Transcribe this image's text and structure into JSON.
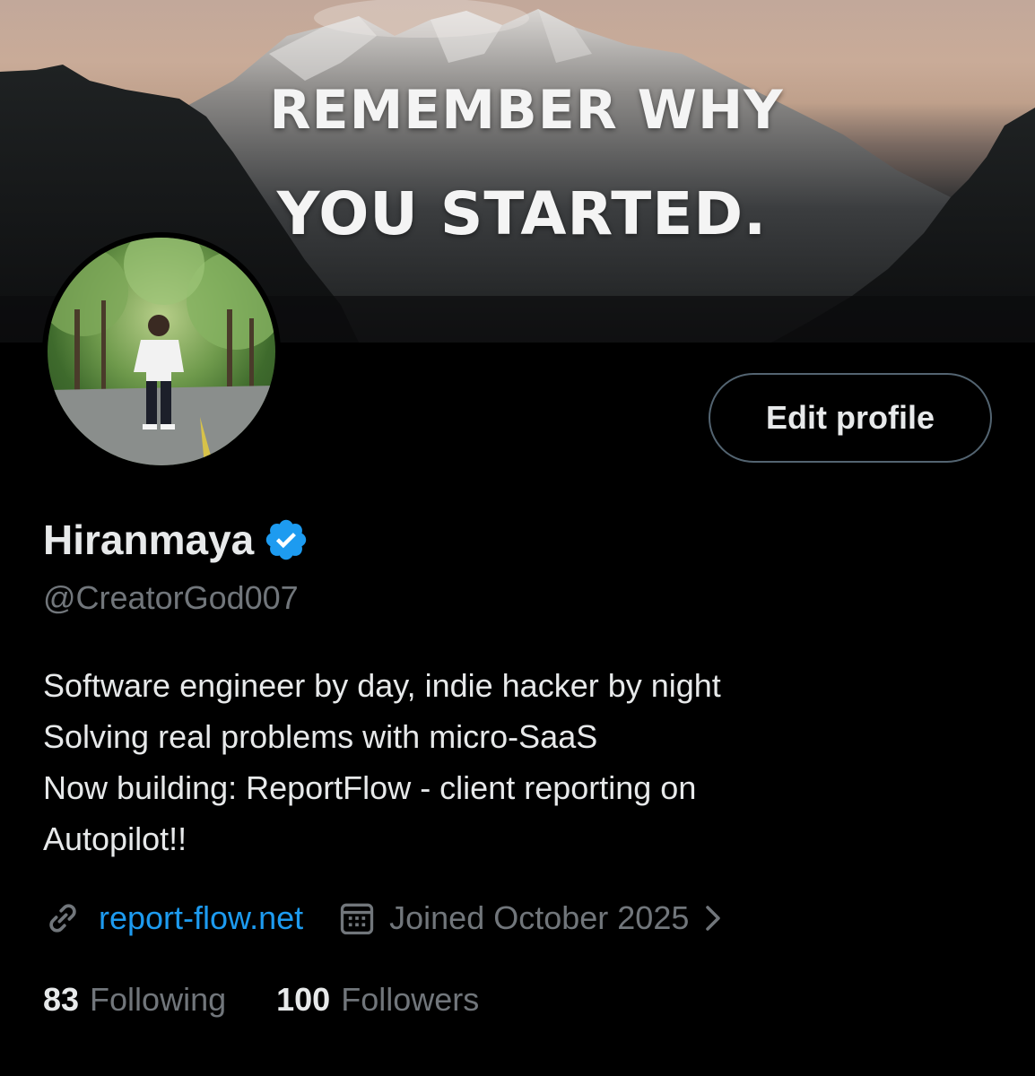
{
  "banner": {
    "line1": "REMEMBER WHY",
    "line2": "YOU STARTED."
  },
  "profile": {
    "display_name": "Hiranmaya",
    "handle": "@CreatorGod007",
    "verified": true,
    "verified_color": "#1d9bf0",
    "edit_button_label": "Edit profile",
    "bio_lines": [
      "Software engineer by day, indie hacker by night",
      "Solving real problems with micro-SaaS",
      "Now building: ReportFlow - client reporting on",
      "Autopilot!!"
    ],
    "website": {
      "icon": "link-icon",
      "text": "report-flow.net"
    },
    "joined": {
      "icon": "calendar-icon",
      "text": "Joined October 2025"
    },
    "stats": {
      "following_count": "83",
      "following_label": "Following",
      "followers_count": "100",
      "followers_label": "Followers"
    }
  },
  "colors": {
    "background": "#000000",
    "text_primary": "#e7e9ea",
    "text_secondary": "#71767b",
    "link": "#1d9bf0",
    "button_border": "#536471"
  }
}
